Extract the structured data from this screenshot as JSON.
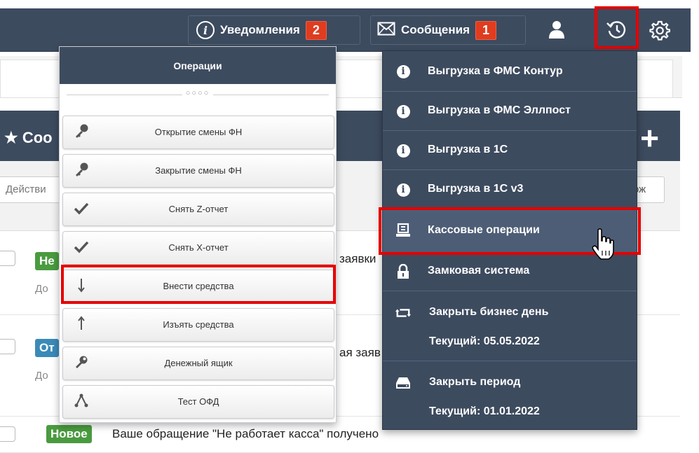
{
  "navbar": {
    "notifications_label": "Уведомления",
    "notifications_count": "2",
    "messages_label": "Сообщения",
    "messages_count": "1",
    "icons": [
      "info-icon",
      "envelope-icon",
      "user-icon",
      "history-icon",
      "gear-icon"
    ]
  },
  "background": {
    "panel_title": "Соо",
    "panel_add": "+",
    "actions_button": "Действи",
    "right_button": "ож",
    "rows": [
      {
        "badge": "Не",
        "text": "заявки",
        "sub": "До"
      },
      {
        "badge": "От",
        "text": "ая заяв",
        "sub": "До"
      },
      {
        "badge": "Новое",
        "text": "Ваше обращение \"Не работает касса\" получено",
        "sub": ""
      }
    ]
  },
  "operations_menu": {
    "title": "Операции",
    "divider": "○○○○",
    "items": [
      {
        "label": "Открытие смены ФН",
        "icon": "key-icon"
      },
      {
        "label": "Закрытие смены ФН",
        "icon": "key-icon"
      },
      {
        "label": "Снять Z-отчет",
        "icon": "check-icon"
      },
      {
        "label": "Снять X-отчет",
        "icon": "check-icon"
      },
      {
        "label": "Внести средства",
        "icon": "arrow-down-icon"
      },
      {
        "label": "Изъять средства",
        "icon": "arrow-up-icon"
      },
      {
        "label": "Денежный ящик",
        "icon": "wrench-icon"
      },
      {
        "label": "Тест ОФД",
        "icon": "network-icon"
      }
    ]
  },
  "history_menu": {
    "items": [
      {
        "label": "Выгрузка в ФМС Контур",
        "icon": "info-icon"
      },
      {
        "label": "Выгрузка в ФМС Эллпост",
        "icon": "info-icon"
      },
      {
        "label": "Выгрузка в 1С",
        "icon": "info-icon"
      },
      {
        "label": "Выгрузка в 1С v3",
        "icon": "info-icon"
      },
      {
        "label": "Кассовые операции",
        "icon": "cash-register-icon"
      },
      {
        "label": "Замковая система",
        "icon": "lock-icon"
      },
      {
        "label": "Закрыть бизнес день",
        "sub": "Текущий: 05.05.2022",
        "icon": "retweet-icon"
      },
      {
        "label": "Закрыть период",
        "sub": "Текущий: 01.01.2022",
        "icon": "hdd-icon"
      }
    ]
  },
  "colors": {
    "navbar": "#3d4b5f",
    "badge": "#e03c1f",
    "highlight": "#e60000",
    "new_label": "#4a9b3f",
    "open_label": "#3a8ab8"
  }
}
